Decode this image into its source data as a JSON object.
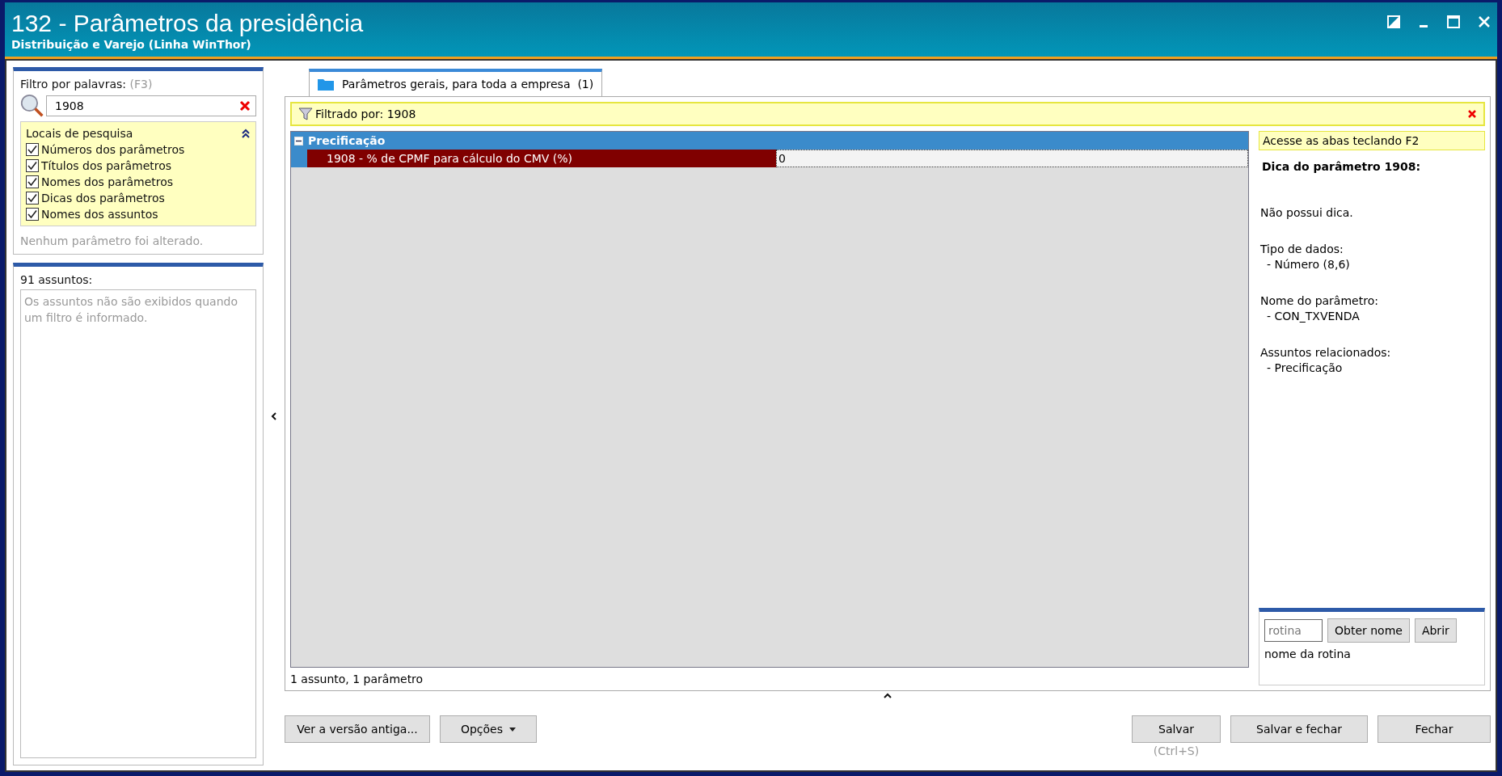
{
  "window": {
    "title": "132 - Parâmetros da presidência",
    "subtitle": "Distribuição e Varejo (Linha WinThor)"
  },
  "filter": {
    "label": "Filtro por palavras:",
    "shortcut": "(F3)",
    "value": "1908"
  },
  "search_locations": {
    "title": "Locais de pesquisa",
    "expanded": true,
    "options": [
      {
        "label": "Números dos parâmetros",
        "checked": true
      },
      {
        "label": "Títulos dos parâmetros",
        "checked": true
      },
      {
        "label": "Nomes dos parâmetros",
        "checked": true
      },
      {
        "label": "Dicas dos parâmetros",
        "checked": true
      },
      {
        "label": "Nomes dos assuntos",
        "checked": true
      }
    ]
  },
  "change_status": "Nenhum parâmetro foi alterado.",
  "subjects": {
    "count_label": "91 assuntos:",
    "message": "Os assuntos não são exibidos quando um filtro é informado."
  },
  "tabs": [
    {
      "label": "Parâmetros gerais, para toda a empresa",
      "count": "(1)",
      "selected": true
    }
  ],
  "filter_bar": {
    "label": "Filtrado por: 1908"
  },
  "groups": [
    {
      "name": "Precificação",
      "expanded": true,
      "parameters": [
        {
          "label": "1908 - % de CPMF para cálculo do CMV (%)",
          "value": "0",
          "selected": true
        }
      ]
    }
  ],
  "grid_status": "1 assunto, 1 parâmetro",
  "info": {
    "hint": "Acesse as abas teclando F2",
    "heading": "Dica do parâmetro 1908:",
    "tip": "Não possui dica.",
    "sections": [
      {
        "label": "Tipo de dados:",
        "value": "- Número (8,6)"
      },
      {
        "label": "Nome do parâmetro:",
        "value": "- CON_TXVENDA"
      },
      {
        "label": "Assuntos relacionados:",
        "value": "- Precificação"
      }
    ]
  },
  "routine": {
    "placeholder": "rotina",
    "buttons": [
      "Obter nome",
      "Abrir"
    ],
    "label": "nome da rotina"
  },
  "left_buttons": [
    {
      "label": "Ver a versão antiga...",
      "kind": "plain"
    },
    {
      "label": "Opções",
      "kind": "dropdown"
    }
  ],
  "right_buttons": [
    {
      "label": "Salvar",
      "hint": "(Ctrl+S)"
    },
    {
      "label": "Salvar e fechar"
    },
    {
      "label": "Fechar"
    }
  ]
}
